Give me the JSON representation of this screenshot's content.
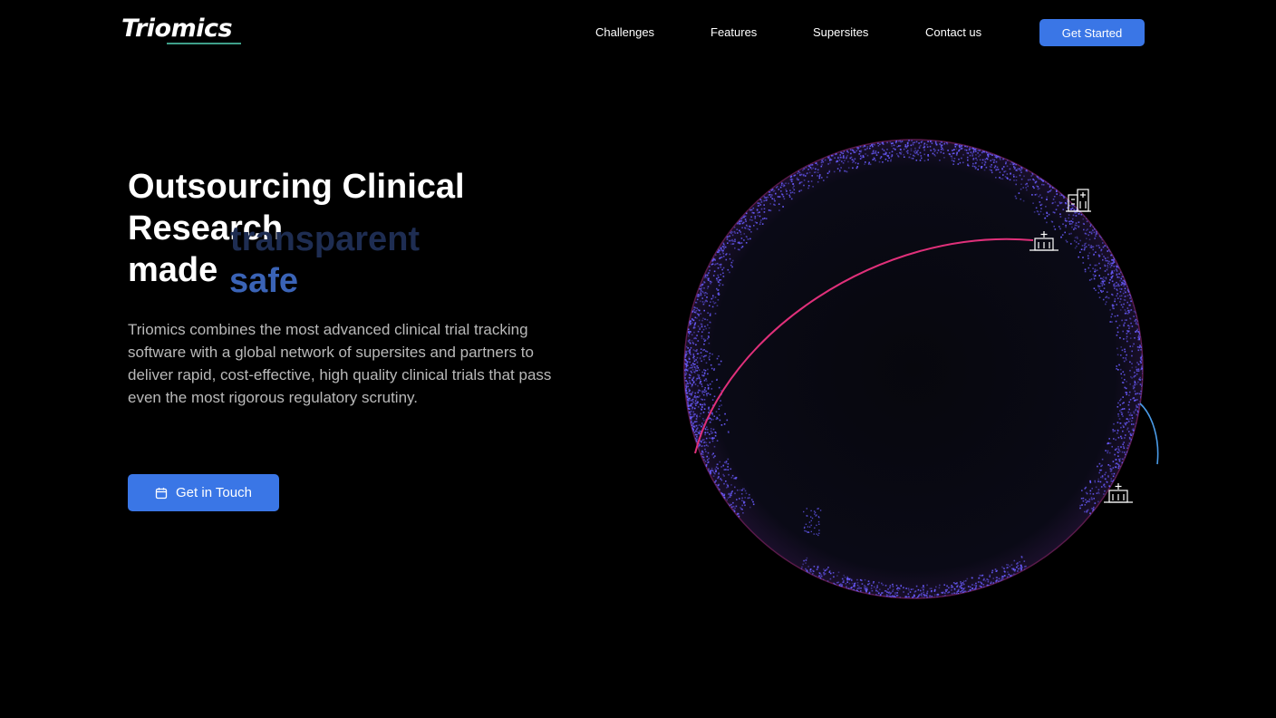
{
  "header": {
    "logo_text": "Triomics",
    "nav": [
      {
        "label": "Challenges"
      },
      {
        "label": "Features"
      },
      {
        "label": "Supersites"
      },
      {
        "label": "Contact us"
      }
    ],
    "cta_label": "Get Started"
  },
  "hero": {
    "title_line1": "Outsourcing Clinical",
    "title_line2": "Research",
    "title_line3": "made",
    "rotating_words": [
      "transparent",
      "safe"
    ],
    "description": "Triomics combines the most advanced clinical trial tracking software with a global network of supersites and partners to deliver rapid, cost-effective, high quality clinical trials that pass even the most rigorous regulatory scrutiny.",
    "cta_label": "Get in Touch",
    "cta_icon": "calendar-icon"
  },
  "globe": {
    "markers": [
      "hospital-icon",
      "hospital-icon",
      "hospital-icon"
    ],
    "colors": {
      "dots": "#6a5cff",
      "arc_primary": "#e0307a",
      "arc_secondary": "#4a9be8",
      "rim": "#7a1a5a"
    }
  },
  "colors": {
    "background": "#000000",
    "accent": "#3a76e6",
    "rotating_active": "#3a63b6",
    "rotating_faded": "#1e2d52"
  }
}
